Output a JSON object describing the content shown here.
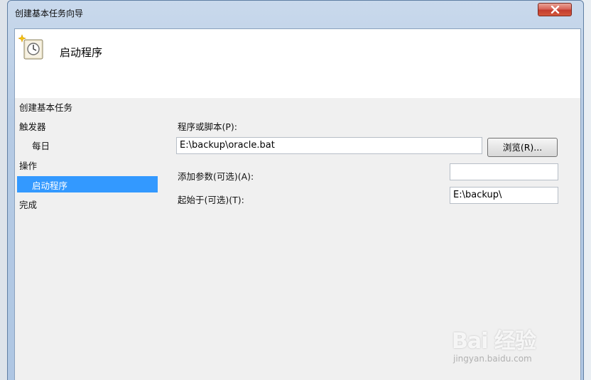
{
  "window": {
    "title": "创建基本任务向导",
    "header_title": "启动程序"
  },
  "nav": {
    "items": [
      {
        "label": "创建基本任务"
      },
      {
        "label": "触发器"
      },
      {
        "label": "每日"
      },
      {
        "label": "操作"
      },
      {
        "label": "启动程序"
      },
      {
        "label": "完成"
      }
    ]
  },
  "form": {
    "program_label": "程序或脚本(P):",
    "program_value": "E:\\backup\\oracle.bat",
    "browse_label": "浏览(R)...",
    "args_label": "添加参数(可选)(A):",
    "args_value": "",
    "startin_label": "起始于(可选)(T):",
    "startin_value": "E:\\backup\\"
  },
  "watermark": {
    "main": "Bai 经验",
    "sub": "jingyan.baidu.com"
  },
  "colors": {
    "selection": "#3399ff",
    "client_bg": "#f0f0f0",
    "close_button": "#c33c2f"
  }
}
